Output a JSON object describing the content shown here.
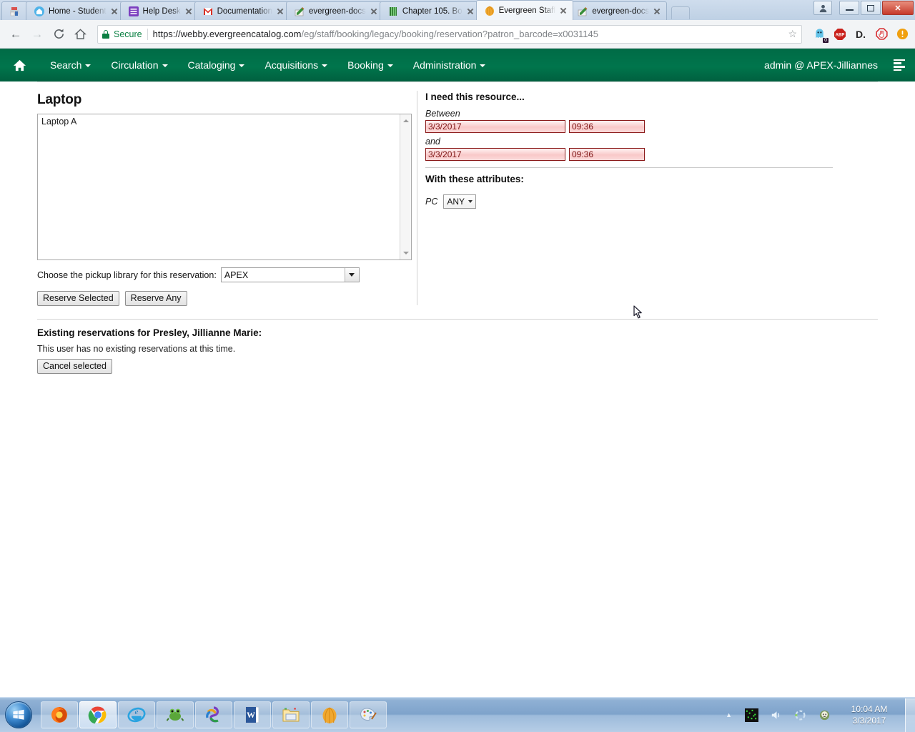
{
  "browser": {
    "tabs": [
      {
        "title": "",
        "favicon": "printer-icon",
        "pinned": true,
        "active": false
      },
      {
        "title": "Home - Student",
        "favicon": "home-blue-icon",
        "pinned": false,
        "active": false
      },
      {
        "title": "Help Desk",
        "favicon": "grid-purple-icon",
        "pinned": false,
        "active": false
      },
      {
        "title": "Documentation",
        "favicon": "gmail-m-icon",
        "pinned": false,
        "active": false
      },
      {
        "title": "evergreen-docs",
        "favicon": "pencil-book-icon",
        "pinned": false,
        "active": false
      },
      {
        "title": "Chapter 105. Bo",
        "favicon": "green-book-icon",
        "pinned": false,
        "active": false
      },
      {
        "title": "Evergreen Staff",
        "favicon": "evergreen-leaf-icon",
        "pinned": false,
        "active": true
      },
      {
        "title": "evergreen-docs",
        "favicon": "pencil-book-icon",
        "pinned": false,
        "active": false
      }
    ],
    "window_controls": {
      "profile": "profile-icon",
      "minimize": "minimize-icon",
      "maximize": "maximize-icon",
      "close": "close-icon"
    },
    "toolbar": {
      "back": "←",
      "forward": "→",
      "reload": "C",
      "home": "⌂",
      "security_label": "Secure",
      "url_domain": "https://webby.evergreencatalog.com",
      "url_path": "/eg/staff/booking/legacy/booking/reservation?patron_barcode=x0031145",
      "bookmark_star": "☆"
    },
    "extensions": [
      {
        "name": "ghostery-icon",
        "badge": "0"
      },
      {
        "name": "adblock-plus-icon",
        "label": "ABP"
      },
      {
        "name": "disconnect-icon",
        "label": "D."
      },
      {
        "name": "opera-stop-icon",
        "label": ""
      },
      {
        "name": "warning-badge-icon",
        "label": "!"
      }
    ]
  },
  "eg_nav": {
    "home_icon": "home-icon",
    "items": [
      {
        "label": "Search",
        "has_caret": true
      },
      {
        "label": "Circulation",
        "has_caret": true
      },
      {
        "label": "Cataloging",
        "has_caret": true
      },
      {
        "label": "Acquisitions",
        "has_caret": true
      },
      {
        "label": "Booking",
        "has_caret": true
      },
      {
        "label": "Administration",
        "has_caret": true
      }
    ],
    "user": "admin @ APEX-Jilliannes",
    "menu_icon": "list-menu-icon"
  },
  "left_panel": {
    "resource_title": "Laptop",
    "resource_list": [
      "Laptop A"
    ],
    "pickup_label": "Choose the pickup library for this reservation:",
    "pickup_value": "APEX",
    "buttons": {
      "reserve_selected": "Reserve Selected",
      "reserve_any": "Reserve Any"
    }
  },
  "right_panel": {
    "heading": "I need this resource...",
    "between_label": "Between",
    "and_label": "and",
    "start_date": "3/3/2017",
    "start_time": "09:36",
    "end_date": "3/3/2017",
    "end_time": "09:36",
    "attributes_heading": "With these attributes:",
    "attributes": [
      {
        "name": "PC",
        "value": "ANY"
      }
    ]
  },
  "bottom_panel": {
    "heading": "Existing reservations for Presley, Jillianne Marie:",
    "empty_message": "This user has no existing reservations at this time.",
    "cancel_button": "Cancel selected"
  },
  "taskbar": {
    "start": "start-orb-icon",
    "apps": [
      {
        "name": "firefox-icon",
        "active": false
      },
      {
        "name": "chrome-icon",
        "active": true
      },
      {
        "name": "internet-explorer-icon",
        "active": false
      },
      {
        "name": "frog-icon",
        "active": false
      },
      {
        "name": "swirl-icon",
        "active": false
      },
      {
        "name": "word-icon",
        "active": false
      },
      {
        "name": "file-explorer-icon",
        "active": false
      },
      {
        "name": "evergreen-leaf-icon",
        "active": false
      },
      {
        "name": "paint-icon",
        "active": false
      }
    ],
    "tray": {
      "expand": "show-hidden-icons-icon",
      "icons": [
        "green-matrix-icon",
        "volume-icon",
        "sync-icon",
        "avatar-icon"
      ],
      "time": "10:04 AM",
      "date": "3/3/2017"
    }
  },
  "colors": {
    "eg_green": "#00754c",
    "error_border": "#8b1a1a",
    "error_bg": "#f9c9c9",
    "secure_green": "#0b8043"
  }
}
